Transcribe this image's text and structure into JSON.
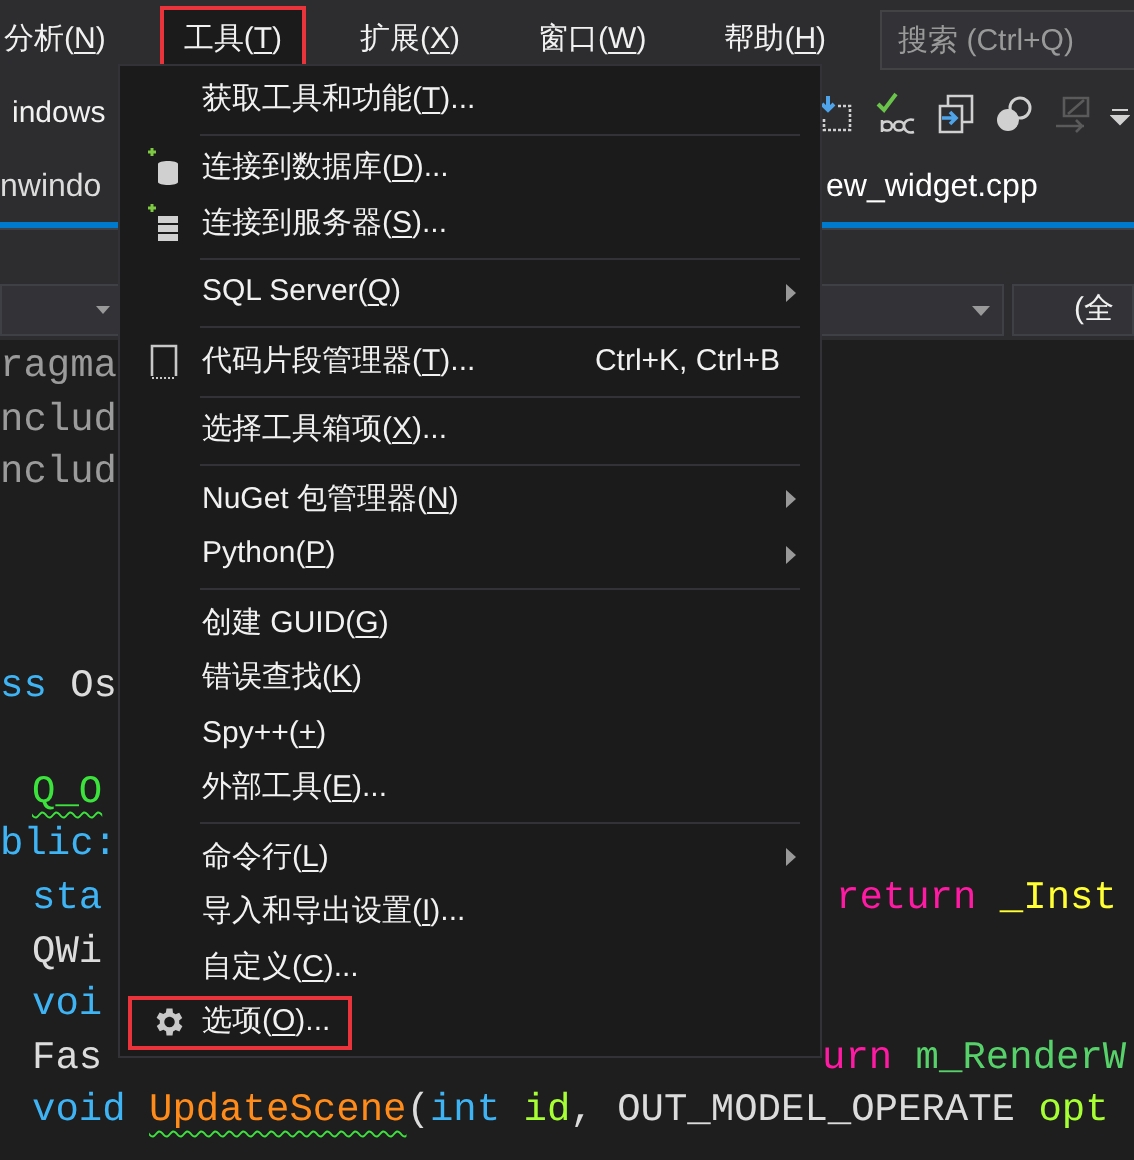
{
  "menu_bar": {
    "items": [
      {
        "pre": "分析(",
        "key": "N",
        "post": ")",
        "open": false,
        "highlighted": false
      },
      {
        "pre": "工具(",
        "key": "T",
        "post": ")",
        "open": true,
        "highlighted": true
      },
      {
        "pre": "扩展(",
        "key": "X",
        "post": ")",
        "open": false,
        "highlighted": false
      },
      {
        "pre": "窗口(",
        "key": "W",
        "post": ")",
        "open": false,
        "highlighted": false
      },
      {
        "pre": "帮助(",
        "key": "H",
        "post": ")",
        "open": false,
        "highlighted": false
      }
    ],
    "search": {
      "placeholder": "搜索 (Ctrl+Q)"
    }
  },
  "toolbar": {
    "label": "indows"
  },
  "tabs": [
    {
      "label": "nwindo",
      "selected": false
    },
    {
      "label": "ew_widget.cpp",
      "selected": true
    }
  ],
  "nav_bar": {
    "scope": "(全"
  },
  "code_lines": [
    {
      "left": [
        {
          "text": "ragma",
          "kind": "directive"
        }
      ]
    },
    {
      "left": [
        {
          "text": "nclud",
          "kind": "directive"
        }
      ]
    },
    {
      "left": [
        {
          "text": "nclud",
          "kind": "directive"
        }
      ]
    },
    {
      "left": [
        {
          "text": "ss",
          "kind": "keyword"
        },
        {
          "text": " Os",
          "kind": "plain"
        }
      ]
    },
    {
      "indent": true,
      "left": [
        {
          "text": "Q_O",
          "kind": "macro",
          "squiggle": true
        }
      ]
    },
    {
      "left": [
        {
          "text": "blic:",
          "kind": "keyword"
        }
      ]
    },
    {
      "indent": true,
      "left": [
        {
          "text": "sta",
          "kind": "keyword"
        }
      ],
      "right": [
        {
          "text": "return",
          "kind": "control"
        },
        {
          "text": " _Inst",
          "kind": "field"
        }
      ]
    },
    {
      "indent": true,
      "left": [
        {
          "text": "QWi",
          "kind": "plain"
        }
      ]
    },
    {
      "indent": true,
      "left": [
        {
          "text": "voi",
          "kind": "keyword"
        }
      ]
    },
    {
      "indent": true,
      "left": [
        {
          "text": "Fas",
          "kind": "plain"
        }
      ],
      "right": [
        {
          "text": "urn",
          "kind": "control"
        },
        {
          "text": " m_RenderW",
          "kind": "member"
        }
      ]
    },
    {
      "indent": true,
      "left": [
        {
          "text": "void ",
          "kind": "keyword"
        },
        {
          "text": "UpdateScene",
          "kind": "function",
          "squiggle": true
        },
        {
          "text": "(",
          "kind": "plain"
        },
        {
          "text": "int ",
          "kind": "keyword"
        },
        {
          "text": "id",
          "kind": "param"
        },
        {
          "text": ", OUT_MODEL_OPERATE ",
          "kind": "plain"
        },
        {
          "text": "opt",
          "kind": "param"
        }
      ]
    }
  ],
  "dropdown_menu": {
    "groups": [
      [
        {
          "pre": "获取工具和功能(",
          "key": "T",
          "post": ")..."
        }
      ],
      [
        {
          "pre": "连接到数据库(",
          "key": "D",
          "post": ")...",
          "kind": "database"
        },
        {
          "pre": "连接到服务器(",
          "key": "S",
          "post": ")...",
          "kind": "server"
        }
      ],
      [
        {
          "pre": "SQL Server(",
          "key": "Q",
          "post": ")",
          "submenu": true
        }
      ],
      [
        {
          "pre": "代码片段管理器(",
          "key": "T",
          "post": ")...",
          "kind": "snippet",
          "shortcut": "Ctrl+K, Ctrl+B"
        }
      ],
      [
        {
          "pre": "选择工具箱项(",
          "key": "X",
          "post": ")..."
        }
      ],
      [
        {
          "pre": "NuGet 包管理器(",
          "key": "N",
          "post": ")",
          "submenu": true
        },
        {
          "pre": "Python(",
          "key": "P",
          "post": ")",
          "submenu": true
        }
      ],
      [
        {
          "pre": "创建 GUID(",
          "key": "G",
          "post": ")"
        },
        {
          "pre": "错误查找(",
          "key": "K",
          "post": ")"
        },
        {
          "pre": "Spy++(",
          "key": "+",
          "post": ")"
        },
        {
          "pre": "外部工具(",
          "key": "E",
          "post": ")..."
        }
      ],
      [
        {
          "pre": "命令行(",
          "key": "L",
          "post": ")",
          "submenu": true
        },
        {
          "pre": "导入和导出设置(",
          "key": "I",
          "post": ")..."
        },
        {
          "pre": "自定义(",
          "key": "C",
          "post": ")..."
        },
        {
          "pre": "选项(",
          "key": "O",
          "post": ")...",
          "kind": "settings",
          "highlighted": true
        }
      ]
    ]
  }
}
